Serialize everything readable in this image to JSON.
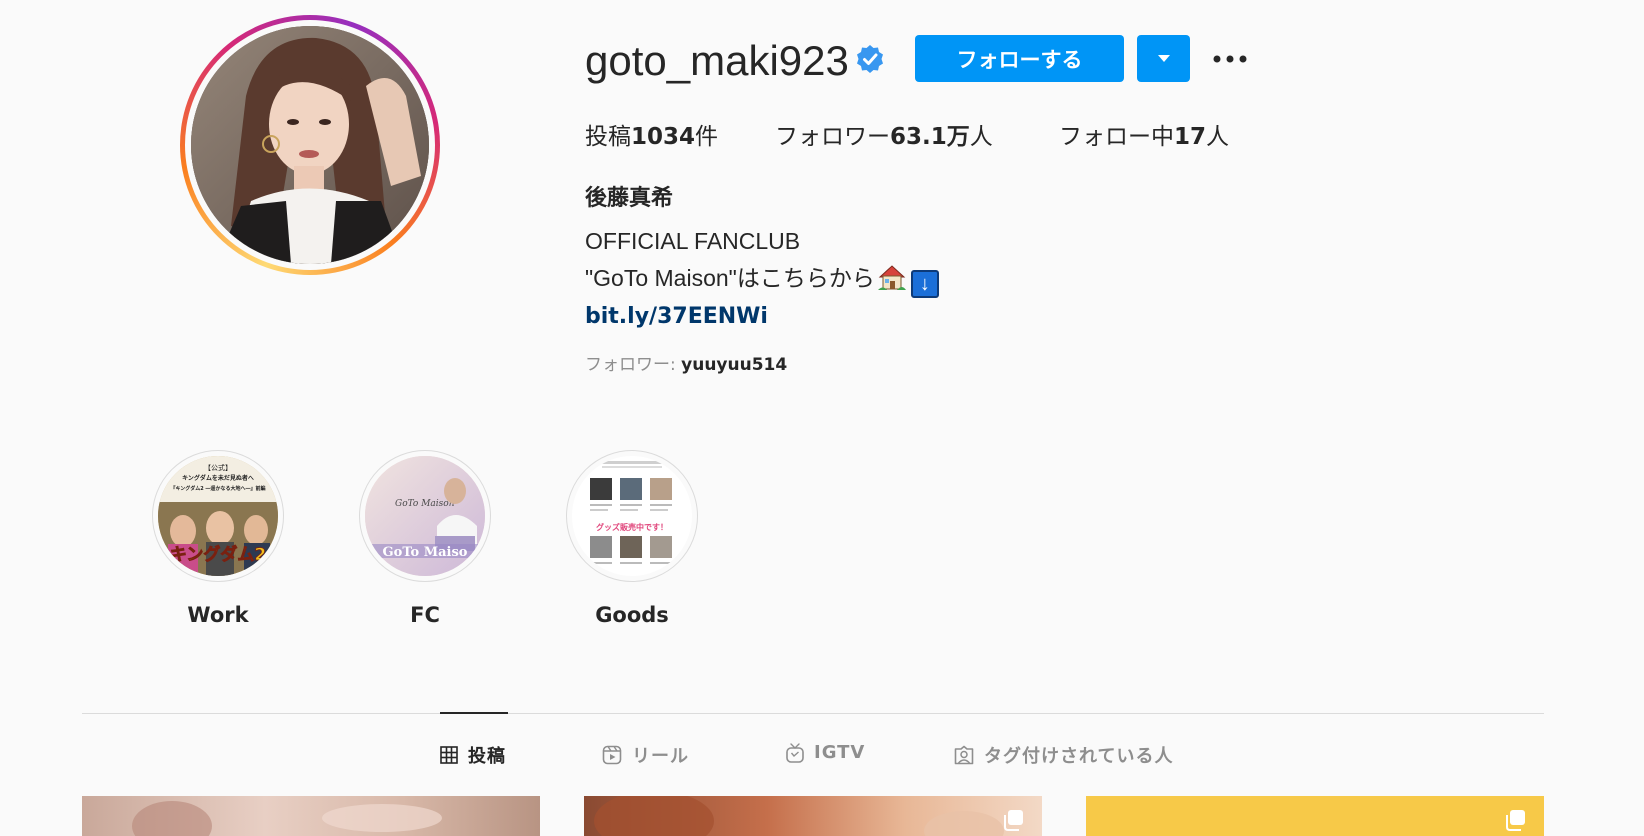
{
  "profile": {
    "username": "goto_maki923",
    "verified": true,
    "follow_label": "フォローする",
    "stats": {
      "posts_prefix": "投稿",
      "posts_count": "1034",
      "posts_suffix": "件",
      "followers_prefix": "フォロワー",
      "followers_count": "63.1万",
      "followers_suffix": "人",
      "following_prefix": "フォロー中",
      "following_count": "17",
      "following_suffix": "人"
    },
    "full_name": "後藤真希",
    "bio_line1": "OFFICIAL FANCLUB",
    "bio_line2": "\"GoTo Maison\"はこちらから",
    "bio_arrow": "↓",
    "link": "bit.ly/37EENWi",
    "followed_by_label": "フォロワー: ",
    "followed_by_name": "yuuyuu514"
  },
  "highlights": [
    {
      "label": "Work"
    },
    {
      "label": "FC"
    },
    {
      "label": "Goods"
    }
  ],
  "highlight_thumb_text": {
    "work_title_1": "【公式】",
    "work_title_2": "キングダムを未だ見ぬ者へ",
    "work_title_3": "『キングダム2 ―遥かなる大地へ―』前編",
    "work_logo": "キングダム2",
    "fc_script": "GoTo Maison",
    "fc_logo": "GoTo Maiso",
    "goods_banner": "グッズ販売中です！"
  },
  "tabs": [
    {
      "label": "投稿",
      "icon": "grid-icon",
      "active": true
    },
    {
      "label": "リール",
      "icon": "reels-icon",
      "active": false
    },
    {
      "label": "IGTV",
      "icon": "igtv-icon",
      "active": false
    },
    {
      "label": "タグ付けされている人",
      "icon": "tagged-icon",
      "active": false
    }
  ],
  "colors": {
    "accent": "#0095f6",
    "link": "#00376b",
    "muted": "#8e8e8e"
  }
}
